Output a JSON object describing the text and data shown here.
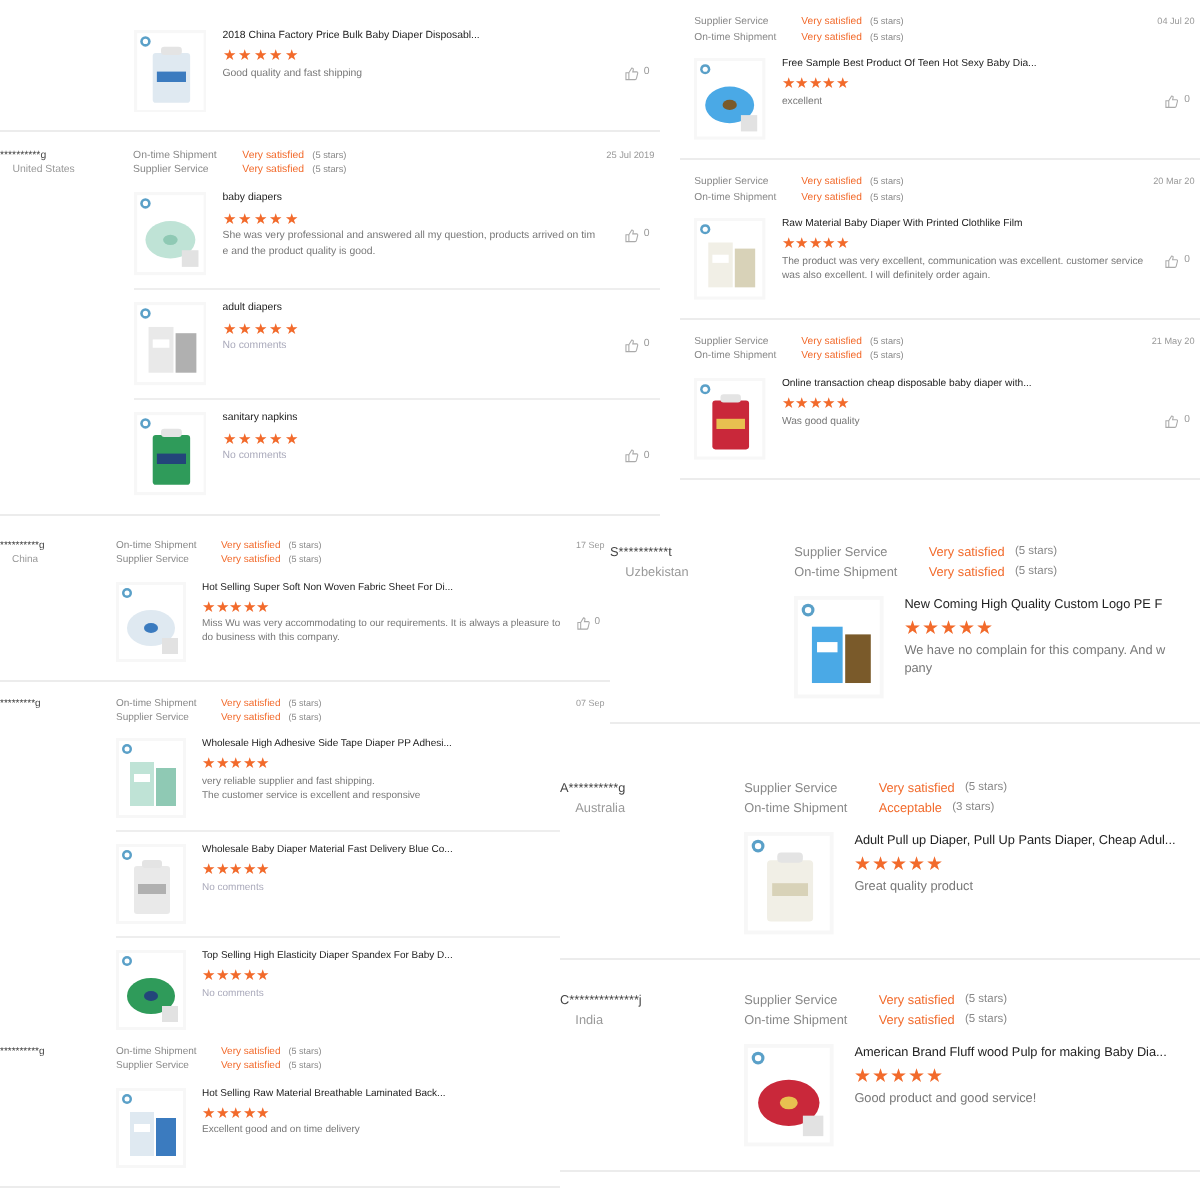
{
  "panels": [
    {
      "reviews": [
        {
          "items": [
            {
              "title": "2018 China Factory Price Bulk Baby Diaper Disposabl...",
              "stars": 5,
              "comment": "Good quality and fast shipping",
              "muted": false,
              "likes": "0"
            }
          ]
        },
        {
          "reviewer": "**********g",
          "country": "United States",
          "date": "25 Jul 2019",
          "ratings": [
            {
              "label": "On-time Shipment",
              "value": "Very satisfied",
              "detail": "(5 stars)"
            },
            {
              "label": "Supplier Service",
              "value": "Very satisfied",
              "detail": "(5 stars)"
            }
          ],
          "items": [
            {
              "title": "baby diapers",
              "stars": 5,
              "comment": "She was very professional and answered all my question, products arrived on tim\ne and the product quality is good.",
              "muted": false,
              "likes": "0"
            },
            {
              "title": "adult diapers",
              "stars": 5,
              "comment": "No comments",
              "muted": true,
              "likes": "0"
            },
            {
              "title": "sanitary napkins",
              "stars": 5,
              "comment": "No comments",
              "muted": true,
              "likes": "0"
            }
          ]
        }
      ]
    },
    {
      "reviews": [
        {
          "date": "04 Jul 20",
          "ratings": [
            {
              "label": "Supplier Service",
              "value": "Very satisfied",
              "detail": "(5 stars)"
            },
            {
              "label": "On-time Shipment",
              "value": "Very satisfied",
              "detail": "(5 stars)"
            }
          ],
          "items": [
            {
              "title": "Free Sample Best Product Of Teen Hot Sexy Baby Dia...",
              "stars": 5,
              "comment": "excellent",
              "muted": false,
              "likes": "0"
            }
          ]
        },
        {
          "date": "20 Mar 20",
          "ratings": [
            {
              "label": "Supplier Service",
              "value": "Very satisfied",
              "detail": "(5 stars)"
            },
            {
              "label": "On-time Shipment",
              "value": "Very satisfied",
              "detail": "(5 stars)"
            }
          ],
          "items": [
            {
              "title": "Raw Material Baby Diaper With Printed Clothlike Film",
              "stars": 5,
              "comment": "The product was very excellent, communication was excellent. customer service\nwas also excellent. I will definitely order again.",
              "muted": false,
              "likes": "0"
            }
          ]
        },
        {
          "date": "21 May 20",
          "ratings": [
            {
              "label": "Supplier Service",
              "value": "Very satisfied",
              "detail": "(5 stars)"
            },
            {
              "label": "On-time Shipment",
              "value": "Very satisfied",
              "detail": "(5 stars)"
            }
          ],
          "items": [
            {
              "title": "Online transaction cheap disposable baby diaper with...",
              "stars": 5,
              "comment": "Was good quality",
              "muted": false,
              "likes": "0"
            }
          ]
        }
      ]
    },
    {
      "reviews": [
        {
          "reviewer": "**********g",
          "country": "China",
          "date": "17 Sep",
          "ratings": [
            {
              "label": "On-time Shipment",
              "value": "Very satisfied",
              "detail": "(5 stars)"
            },
            {
              "label": "Supplier Service",
              "value": "Very satisfied",
              "detail": "(5 stars)"
            }
          ],
          "items": [
            {
              "title": "Hot Selling Super Soft Non Woven Fabric Sheet For Di...",
              "stars": 5,
              "comment": "Miss Wu was very accommodating to our requirements. It is always a pleasure to\ndo business with this company.",
              "muted": false,
              "likes": "0"
            }
          ]
        },
        {
          "reviewer": "*********g",
          "date": "07 Sep",
          "ratings": [
            {
              "label": "On-time Shipment",
              "value": "Very satisfied",
              "detail": "(5 stars)"
            },
            {
              "label": "Supplier Service",
              "value": "Very satisfied",
              "detail": "(5 stars)"
            }
          ],
          "items": [
            {
              "title": "Wholesale High Adhesive Side Tape Diaper PP Adhesi...",
              "stars": 5,
              "comment": "very reliable supplier and fast shipping.\nThe customer service is excellent and responsive",
              "muted": false
            },
            {
              "title": "Wholesale Baby Diaper Material Fast Delivery Blue Co...",
              "stars": 5,
              "comment": "No comments",
              "muted": true
            },
            {
              "title": "Top Selling High Elasticity Diaper Spandex For Baby D...",
              "stars": 5,
              "comment": "No comments",
              "muted": true
            }
          ]
        }
      ]
    },
    {
      "reviews": [
        {
          "reviewer": "S**********t",
          "country": "Uzbekistan",
          "ratings": [
            {
              "label": "Supplier Service",
              "value": "Very satisfied",
              "detail": "(5 stars)"
            },
            {
              "label": "On-time Shipment",
              "value": "Very satisfied",
              "detail": "(5 stars)"
            }
          ],
          "items": [
            {
              "title": "New Coming High Quality Custom Logo PE F",
              "stars": 5,
              "comment": "We have no complain for this company. And w\npany",
              "muted": false
            }
          ]
        }
      ]
    },
    {
      "reviews": [
        {
          "reviewer": "A**********g",
          "country": "Australia",
          "ratings": [
            {
              "label": "Supplier Service",
              "value": "Very satisfied",
              "detail": "(5 stars)"
            },
            {
              "label": "On-time Shipment",
              "value": "Acceptable",
              "detail": "(3 stars)"
            }
          ],
          "items": [
            {
              "title": "Adult Pull up Diaper, Pull Up Pants Diaper, Cheap Adul...",
              "stars": 5,
              "comment": "Great quality product",
              "muted": false
            }
          ]
        }
      ]
    },
    {
      "reviews": [
        {
          "reviewer": "C**************j",
          "country": "India",
          "ratings": [
            {
              "label": "Supplier Service",
              "value": "Very satisfied",
              "detail": "(5 stars)"
            },
            {
              "label": "On-time Shipment",
              "value": "Very satisfied",
              "detail": "(5 stars)"
            }
          ],
          "items": [
            {
              "title": "American Brand Fluff wood Pulp for making Baby Dia...",
              "stars": 5,
              "comment": "Good product and good service!",
              "muted": false
            }
          ]
        }
      ]
    },
    {
      "reviews": [
        {
          "reviewer": "**********g",
          "ratings": [
            {
              "label": "On-time Shipment",
              "value": "Very satisfied",
              "detail": "(5 stars)"
            },
            {
              "label": "Supplier Service",
              "value": "Very satisfied",
              "detail": "(5 stars)"
            }
          ],
          "items": [
            {
              "title": "Hot Selling Raw Material Breathable Laminated Back...",
              "stars": 5,
              "comment": "Excellent good and on time delivery",
              "muted": false
            }
          ]
        }
      ]
    }
  ]
}
